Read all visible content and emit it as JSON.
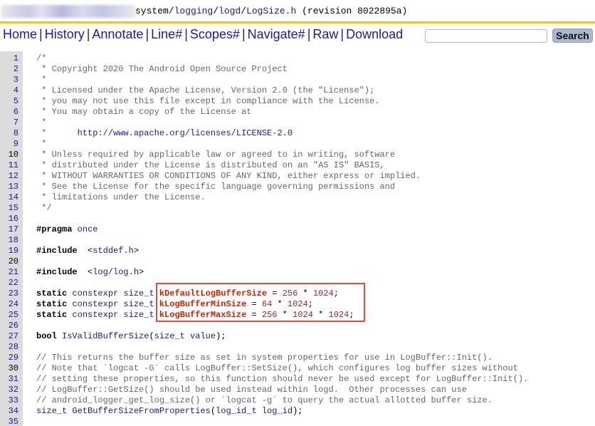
{
  "title": {
    "path": [
      {
        "text": "system",
        "link": false
      },
      {
        "text": "/",
        "link": false
      },
      {
        "text": "logging",
        "link": true
      },
      {
        "text": "/",
        "link": false
      },
      {
        "text": "logd",
        "link": true
      },
      {
        "text": "/",
        "link": false
      },
      {
        "text": "LogSize.h",
        "link": true
      },
      {
        "text": " (revision 8022895a)",
        "link": false
      }
    ]
  },
  "accent_color": "#f5c518",
  "nav": {
    "items": [
      "Home",
      "History",
      "Annotate",
      "Line#",
      "Scopes#",
      "Navigate#",
      "Raw",
      "Download"
    ],
    "search_value": "",
    "search_label": "Search"
  },
  "highlight_color": "#e8493a",
  "code": [
    [
      [
        "c",
        "/*"
      ]
    ],
    [
      [
        "c",
        " * Copyright 2020 The Android Open Source Project"
      ]
    ],
    [
      [
        "c",
        " *"
      ]
    ],
    [
      [
        "c",
        " * Licensed under the Apache License, Version 2.0 (the \"License\");"
      ]
    ],
    [
      [
        "c",
        " * you may not use this file except in compliance with the License."
      ]
    ],
    [
      [
        "c",
        " * You may obtain a copy of the License at"
      ]
    ],
    [
      [
        "c",
        " *"
      ]
    ],
    [
      [
        "c",
        " *      "
      ],
      [
        "u",
        "http://www.apache.org/licenses/LICENSE-2.0"
      ]
    ],
    [
      [
        "c",
        " *"
      ]
    ],
    [
      [
        "c",
        " * Unless required by applicable law or agreed to in writing, software"
      ]
    ],
    [
      [
        "c",
        " * distributed under the License is distributed on an \"AS IS\" BASIS,"
      ]
    ],
    [
      [
        "c",
        " * WITHOUT WARRANTIES OR CONDITIONS OF ANY KIND, either express or implied."
      ]
    ],
    [
      [
        "c",
        " * See the License for the specific language governing permissions and"
      ]
    ],
    [
      [
        "c",
        " * limitations under the License."
      ]
    ],
    [
      [
        "c",
        " */"
      ]
    ],
    [],
    [
      [
        "k",
        "#pragma"
      ],
      [
        "t",
        " once"
      ]
    ],
    [],
    [
      [
        "k",
        "#include"
      ],
      [
        "",
        "  <"
      ],
      [
        "t",
        "stddef.h"
      ],
      [
        "",
        ">"
      ]
    ],
    [],
    [
      [
        "k",
        "#include"
      ],
      [
        "",
        "  <"
      ],
      [
        "t",
        "log/log.h"
      ],
      [
        "",
        ">"
      ]
    ],
    [],
    [
      [
        "k",
        "static"
      ],
      [
        "t",
        " constexpr size_t "
      ],
      [
        "d",
        "kDefaultLogBufferSize"
      ],
      [
        "",
        " = "
      ],
      [
        "n",
        "256"
      ],
      [
        "",
        " * "
      ],
      [
        "n",
        "1024"
      ],
      [
        "",
        ";"
      ]
    ],
    [
      [
        "k",
        "static"
      ],
      [
        "t",
        " constexpr size_t "
      ],
      [
        "d",
        "kLogBufferMinSize"
      ],
      [
        "",
        " = "
      ],
      [
        "n",
        "64"
      ],
      [
        "",
        " * "
      ],
      [
        "n",
        "1024"
      ],
      [
        "",
        ";"
      ]
    ],
    [
      [
        "k",
        "static"
      ],
      [
        "t",
        " constexpr size_t "
      ],
      [
        "d",
        "kLogBufferMaxSize"
      ],
      [
        "",
        " = "
      ],
      [
        "n",
        "256"
      ],
      [
        "",
        " * "
      ],
      [
        "n",
        "1024"
      ],
      [
        "",
        " * "
      ],
      [
        "n",
        "1024"
      ],
      [
        "",
        ";"
      ]
    ],
    [],
    [
      [
        "k",
        "bool"
      ],
      [
        "t",
        " IsValidBufferSize"
      ],
      [
        "",
        "("
      ],
      [
        "t",
        "size_t value"
      ],
      [
        "",
        ");"
      ]
    ],
    [],
    [
      [
        "c",
        "// This returns the buffer size as set in system properties for use in LogBuffer::Init()."
      ]
    ],
    [
      [
        "c",
        "// Note that `logcat -G` calls LogBuffer::SetSize(), which configures log buffer sizes without"
      ]
    ],
    [
      [
        "c",
        "// setting these properties, so this function should never be used except for LogBuffer::Init()."
      ]
    ],
    [
      [
        "c",
        "// LogBuffer::GetSize() should be used instead within logd.  Other processes can use"
      ]
    ],
    [
      [
        "c",
        "// android_logger_get_log_size() or `logcat -g` to query the actual allotted buffer size."
      ]
    ],
    [
      [
        "t",
        "size_t GetBufferSizeFromProperties"
      ],
      [
        "",
        "("
      ],
      [
        "t",
        "log_id_t log_id"
      ],
      [
        "",
        ");"
      ]
    ],
    []
  ]
}
